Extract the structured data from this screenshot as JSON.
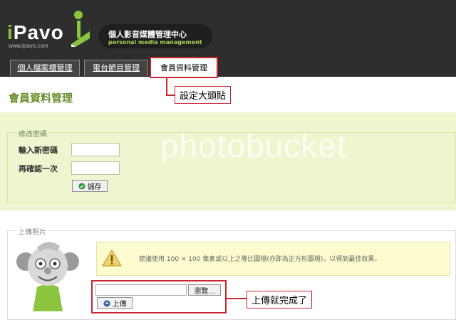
{
  "header": {
    "logo_text": "iPavo",
    "logo_url": "www.ipavo.com",
    "title": "個人影音媒體管理中心",
    "subtitle": "personal media management"
  },
  "tabs": [
    {
      "label": "個人檔案櫃管理",
      "active": false
    },
    {
      "label": "電台節目管理",
      "active": false
    },
    {
      "label": "會員資料管理",
      "active": true
    }
  ],
  "annotations": {
    "avatar_callout": "設定大頭貼",
    "upload_callout": "上傳就完成了"
  },
  "page_title": "會員資料管理",
  "password_section": {
    "legend": "修改密碼",
    "new_password_label": "輸入新密碼",
    "confirm_label": "再確認一次",
    "save_label": "儲存"
  },
  "watermark": "photobucket",
  "upload_section": {
    "legend": "上傳照片",
    "warning": "建議使用 100 × 100 像素或以上之等比圖檔(亦即為正方形圖檔)，以得到最佳效果。",
    "browse_label": "瀏覽...",
    "upload_label": "上傳"
  },
  "colors": {
    "accent_green": "#8bc43f",
    "highlight_red": "#c9262e",
    "band_green": "#eef6cf"
  }
}
